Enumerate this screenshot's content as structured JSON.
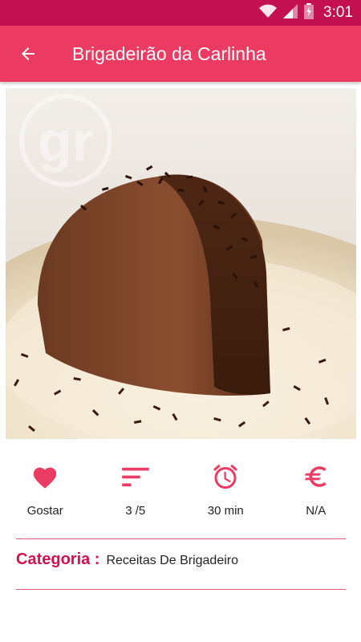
{
  "status_bar": {
    "time": "3:01",
    "icons": [
      "wifi-icon",
      "signal-icon",
      "battery-icon"
    ]
  },
  "app_bar": {
    "title": "Brigadeirão da Carlinha",
    "back_icon": "arrow-left-icon"
  },
  "hero_image": {
    "description_icon": "recipe-photo",
    "watermark": "gr"
  },
  "stats": [
    {
      "icon": "heart-icon",
      "label": "Gostar"
    },
    {
      "icon": "sort-icon",
      "label": "3 /5"
    },
    {
      "icon": "alarm-clock-icon",
      "label": "30 min"
    },
    {
      "icon": "euro-icon",
      "label": "N/A"
    }
  ],
  "category": {
    "key": "Categoria :",
    "value": "Receitas De Brigadeiro"
  },
  "colors": {
    "accent": "#ec3b63",
    "status_bar": "#c2114e",
    "icon": "#ec3b63",
    "category_key": "#d4104e"
  }
}
